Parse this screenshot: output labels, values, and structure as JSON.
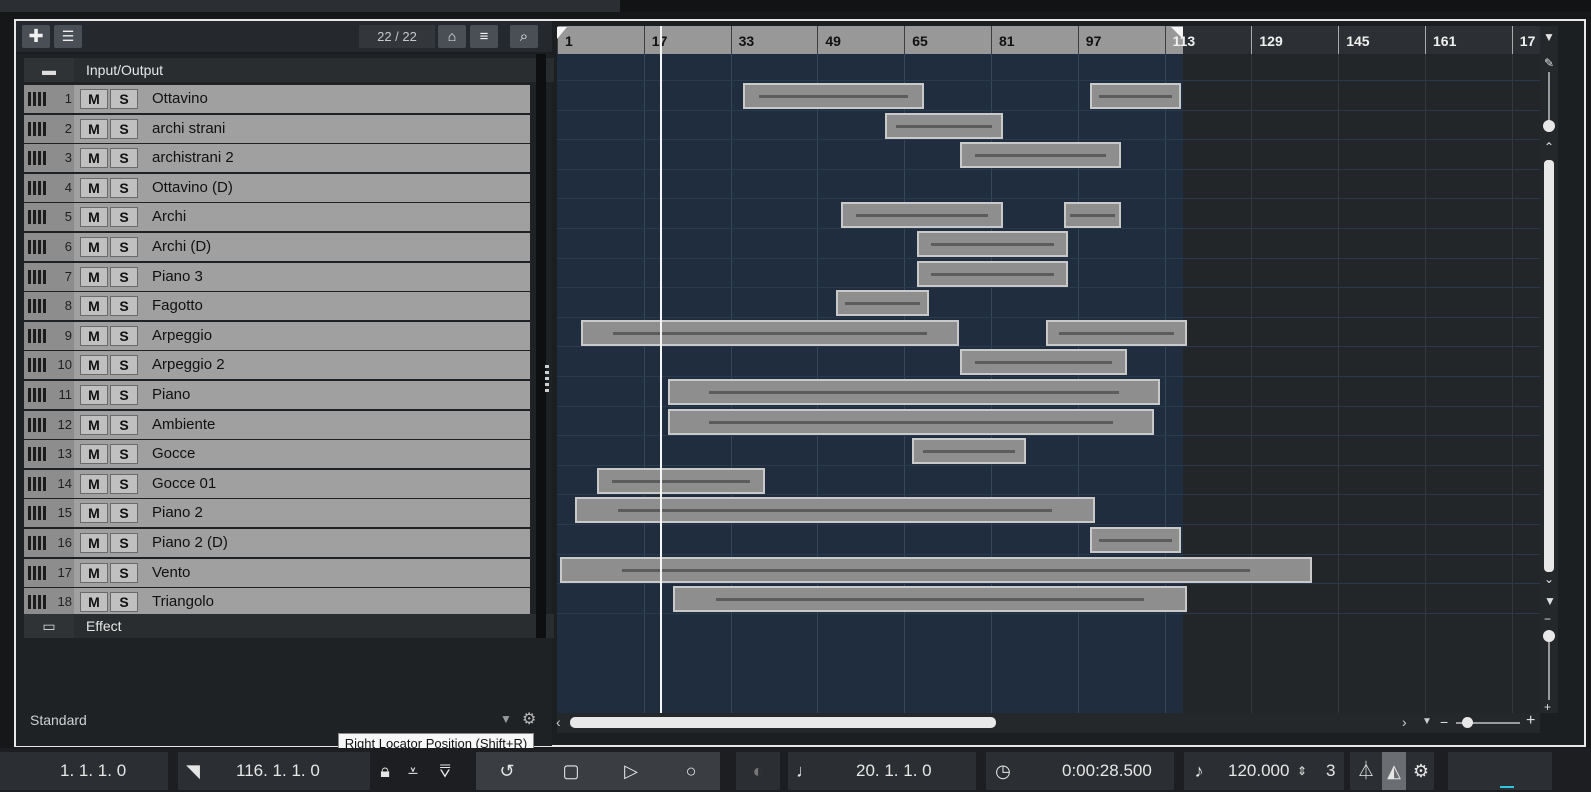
{
  "tracklist": {
    "track_count": "22 / 22",
    "folders": [
      {
        "name": "Input/Output"
      },
      {
        "name": "Effect"
      }
    ],
    "tracks": [
      {
        "num": "1",
        "name": "Ottavino"
      },
      {
        "num": "2",
        "name": "archi strani"
      },
      {
        "num": "3",
        "name": "archistrani 2"
      },
      {
        "num": "4",
        "name": "Ottavino (D)"
      },
      {
        "num": "5",
        "name": "Archi"
      },
      {
        "num": "6",
        "name": "Archi (D)"
      },
      {
        "num": "7",
        "name": "Piano 3"
      },
      {
        "num": "8",
        "name": "Fagotto"
      },
      {
        "num": "9",
        "name": "Arpeggio"
      },
      {
        "num": "10",
        "name": "Arpeggio 2"
      },
      {
        "num": "11",
        "name": "Piano"
      },
      {
        "num": "12",
        "name": "Ambiente"
      },
      {
        "num": "13",
        "name": "Gocce"
      },
      {
        "num": "14",
        "name": "Gocce 01"
      },
      {
        "num": "15",
        "name": "Piano 2"
      },
      {
        "num": "16",
        "name": "Piano 2 (D)"
      },
      {
        "num": "17",
        "name": "Vento"
      },
      {
        "num": "18",
        "name": "Triangolo"
      }
    ],
    "mute_label": "M",
    "solo_label": "S",
    "visibility_preset": "Standard"
  },
  "ruler": {
    "bars": [
      "1",
      "17",
      "33",
      "49",
      "65",
      "81",
      "97",
      "113",
      "129",
      "145",
      "161",
      "17"
    ]
  },
  "tooltip": "Right Locator Position (Shift+R)",
  "transport": {
    "left_locator": "1. 1. 1.   0",
    "right_locator": "116. 1. 1.   0",
    "position_bars": "20. 1. 1.   0",
    "position_time": "0:00:28.500",
    "tempo": "120.000",
    "signature_partial": "3"
  }
}
